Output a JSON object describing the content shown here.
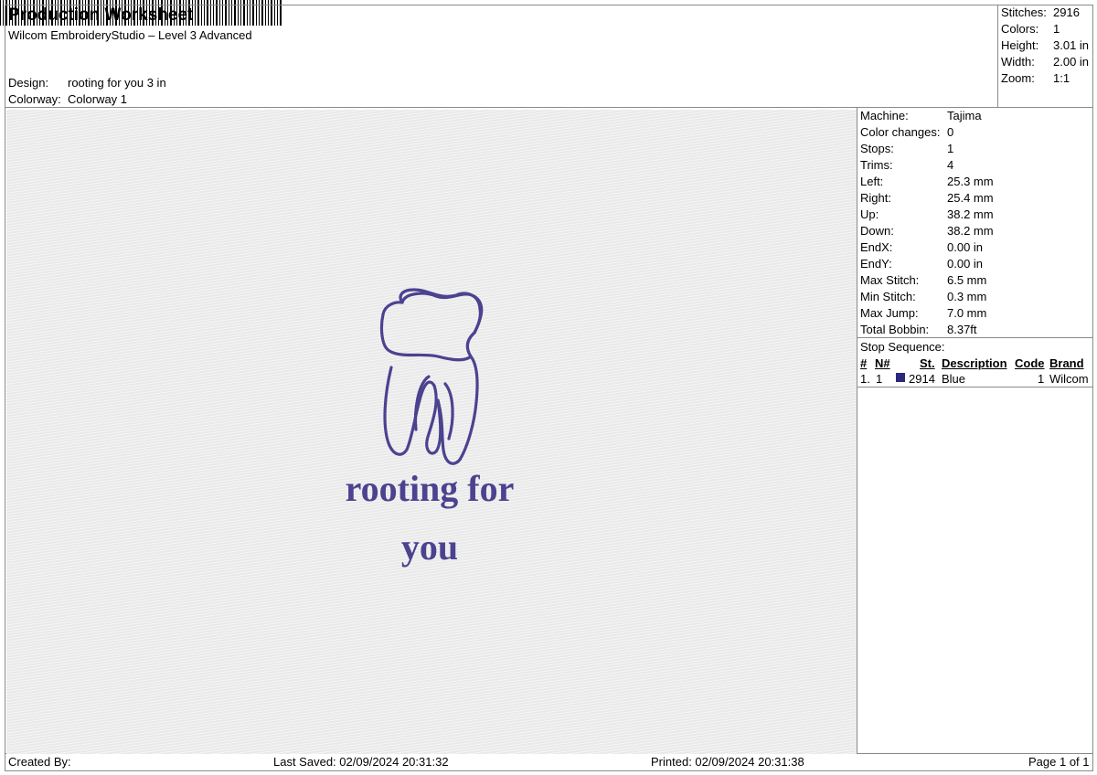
{
  "header": {
    "title": "Production Worksheet",
    "subtitle": "Wilcom EmbroideryStudio – Level 3 Advanced",
    "design_label": "Design:",
    "design_value": "rooting for you 3 in",
    "colorway_label": "Colorway:",
    "colorway_value": "Colorway 1"
  },
  "summary": [
    {
      "label": "Stitches:",
      "value": "2916"
    },
    {
      "label": "Colors:",
      "value": "1"
    },
    {
      "label": "Height:",
      "value": "3.01 in"
    },
    {
      "label": "Width:",
      "value": "2.00 in"
    },
    {
      "label": "Zoom:",
      "value": "1:1"
    }
  ],
  "machine_stats": [
    {
      "label": "Machine:",
      "value": "Tajima"
    },
    {
      "label": "Color changes:",
      "value": "0"
    },
    {
      "label": "Stops:",
      "value": "1"
    },
    {
      "label": "Trims:",
      "value": "4"
    },
    {
      "label": "Left:",
      "value": "25.3 mm"
    },
    {
      "label": "Right:",
      "value": "25.4 mm"
    },
    {
      "label": "Up:",
      "value": "38.2 mm"
    },
    {
      "label": "Down:",
      "value": "38.2 mm"
    },
    {
      "label": "EndX:",
      "value": "0.00 in"
    },
    {
      "label": "EndY:",
      "value": "0.00 in"
    },
    {
      "label": "Max Stitch:",
      "value": "6.5 mm"
    },
    {
      "label": "Min Stitch:",
      "value": "0.3 mm"
    },
    {
      "label": "Max Jump:",
      "value": "7.0 mm"
    },
    {
      "label": "Total Bobbin:",
      "value": "8.37ft"
    }
  ],
  "stop_sequence": {
    "title": "Stop Sequence:",
    "columns": {
      "num": "#",
      "n": "N#",
      "st": "St.",
      "description": "Description",
      "code": "Code",
      "brand": "Brand"
    },
    "rows": [
      {
        "num": "1.",
        "n": "1",
        "st": "2914",
        "description": "Blue",
        "code": "1",
        "brand": "Wilcom",
        "color": "#2b2a7a"
      }
    ]
  },
  "design": {
    "text_line1": "rooting for",
    "text_line2": "you",
    "thread_color": "#4b4290"
  },
  "footer": {
    "created_by": "Created By:",
    "last_saved": "Last Saved: 02/09/2024 20:31:32",
    "printed": "Printed: 02/09/2024 20:31:38",
    "page": "Page 1 of 1"
  }
}
